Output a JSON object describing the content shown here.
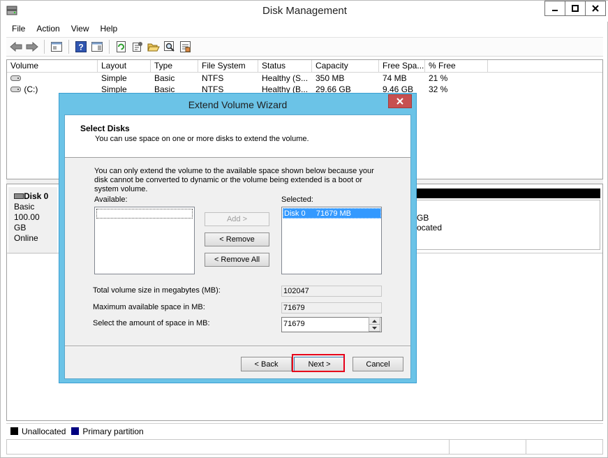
{
  "window": {
    "title": "Disk Management",
    "controls": [
      "minimize",
      "maximize",
      "close"
    ]
  },
  "menu": [
    "File",
    "Action",
    "View",
    "Help"
  ],
  "volume_list": {
    "columns": [
      "Volume",
      "Layout",
      "Type",
      "File System",
      "Status",
      "Capacity",
      "Free Spa...",
      "% Free"
    ],
    "rows": [
      {
        "volume": "",
        "layout": "Simple",
        "type": "Basic",
        "fs": "NTFS",
        "status": "Healthy (S...",
        "capacity": "350 MB",
        "free": "74 MB",
        "pct": "21 %"
      },
      {
        "volume": "(C:)",
        "layout": "Simple",
        "type": "Basic",
        "fs": "NTFS",
        "status": "Healthy (B...",
        "capacity": "29.66 GB",
        "free": "9.46 GB",
        "pct": "32 %"
      }
    ]
  },
  "disk": {
    "name": "Disk 0",
    "type": "Basic",
    "size": "100.00 GB",
    "state": "Online",
    "partition_text_1": "GB",
    "partition_text_2": "ocated"
  },
  "legend": {
    "unallocated": "Unallocated",
    "primary": "Primary partition",
    "unallocated_color": "#000000",
    "primary_color": "#000080"
  },
  "wizard": {
    "title": "Extend Volume Wizard",
    "header_title": "Select Disks",
    "header_sub": "You can use space on one or more disks to extend the volume.",
    "description": "You can only extend the volume to the available space shown below because your disk cannot be converted to dynamic or the volume being extended is a boot or system volume.",
    "available_label": "Available:",
    "selected_label": "Selected:",
    "selected_item": "Disk 0     71679 MB",
    "add_label": "Add >",
    "remove_label": "< Remove",
    "remove_all_label": "< Remove All",
    "total_label": "Total volume size in megabytes (MB):",
    "total_value": "102047",
    "max_label": "Maximum available space in MB:",
    "max_value": "71679",
    "amount_label": "Select the amount of space in MB:",
    "amount_value": "71679",
    "back_label": "< Back",
    "next_label": "Next >",
    "cancel_label": "Cancel"
  }
}
